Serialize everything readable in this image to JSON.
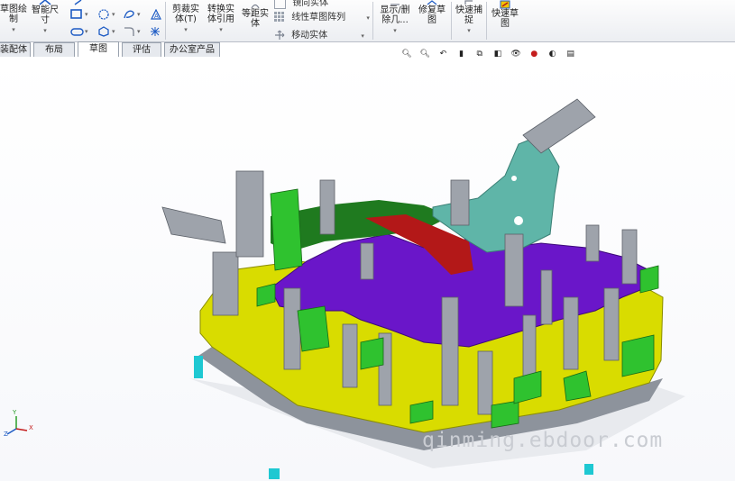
{
  "ribbon": {
    "sketch_label": "草图绘\n制",
    "smart_dimension_label": "智能尺\n寸",
    "trim_label": "剪裁实\n体(T)",
    "convert_label": "转换实\n体引用",
    "offset_label": "等距实\n体",
    "mirror_row": "镜向实体",
    "linear_pattern_row": "线性草图阵列",
    "move_row": "移动实体",
    "show_delete_label": "显示/删\n除几...",
    "repair_label": "修复草\n图",
    "quick_snap_label": "快速捕\n捉",
    "rapid_sketch_label": "快速草\n图"
  },
  "tabs": [
    {
      "label": "装配体",
      "active": false
    },
    {
      "label": "布局",
      "active": false
    },
    {
      "label": "草图",
      "active": true
    },
    {
      "label": "评估",
      "active": false
    },
    {
      "label": "办公室产品",
      "active": false
    }
  ],
  "watermark": "qinming.ebdoor.com",
  "triad": {
    "x": "X",
    "y": "Y",
    "z": "Z"
  },
  "colors": {
    "accent": "#1d5bc4",
    "yellow_plate": "#d9dc00",
    "purple_part": "#6a16c9",
    "green_blocks": "#2fc22f",
    "teal_part": "#5fb5a8",
    "dark_green": "#1f7a1f",
    "red_part": "#b31818",
    "grey_fixture": "#9ea3ab"
  }
}
